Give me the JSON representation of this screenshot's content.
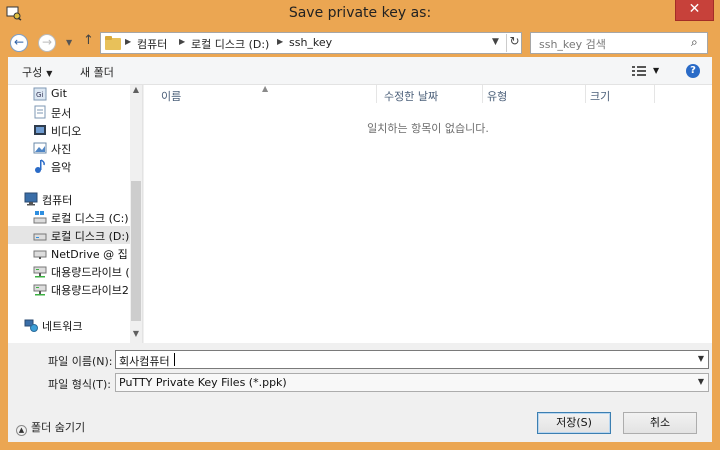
{
  "window": {
    "title": "Save private key as:",
    "close_label": "✕"
  },
  "navigation": {
    "back_icon": "arrow-left-icon",
    "forward_icon": "arrow-right-icon",
    "up_icon": "arrow-up-icon",
    "breadcrumbs": [
      "컴퓨터",
      "로컬 디스크 (D:)",
      "ssh_key"
    ],
    "search_placeholder": "ssh_key 검색"
  },
  "toolbar": {
    "organize_label": "구성",
    "new_folder_label": "새 폴더"
  },
  "sidebar": {
    "items": [
      {
        "label": "Git",
        "icon": "library-git-icon"
      },
      {
        "label": "문서",
        "icon": "documents-icon"
      },
      {
        "label": "비디오",
        "icon": "video-icon"
      },
      {
        "label": "사진",
        "icon": "pictures-icon"
      },
      {
        "label": "음악",
        "icon": "music-icon"
      },
      {
        "label": "컴퓨터",
        "icon": "computer-icon"
      },
      {
        "label": "로컬 디스크 (C:)",
        "icon": "drive-c-icon"
      },
      {
        "label": "로컬 디스크 (D:)",
        "icon": "drive-d-icon"
      },
      {
        "label": "NetDrive @ 집 (H",
        "icon": "network-drive-icon"
      },
      {
        "label": "대용량드라이브 (",
        "icon": "network-drive-icon"
      },
      {
        "label": "대용량드라이브2",
        "icon": "network-drive-icon"
      },
      {
        "label": "네트워크",
        "icon": "network-icon"
      }
    ]
  },
  "filelist": {
    "columns": [
      "이름",
      "수정한 날짜",
      "유형",
      "크기"
    ],
    "empty_message": "일치하는 항목이 없습니다."
  },
  "form": {
    "filename_label": "파일 이름(N):",
    "filename_value": "회사컴퓨터",
    "filetype_label": "파일 형식(T):",
    "filetype_value": "PuTTY Private Key Files (*.ppk)"
  },
  "footer": {
    "hide_folders_label": "폴더 숨기기",
    "save_label": "저장(S)",
    "cancel_label": "취소"
  },
  "colors": {
    "frame": "#eba652",
    "close_button": "#c7413a",
    "accent": "#2a6bc7"
  }
}
